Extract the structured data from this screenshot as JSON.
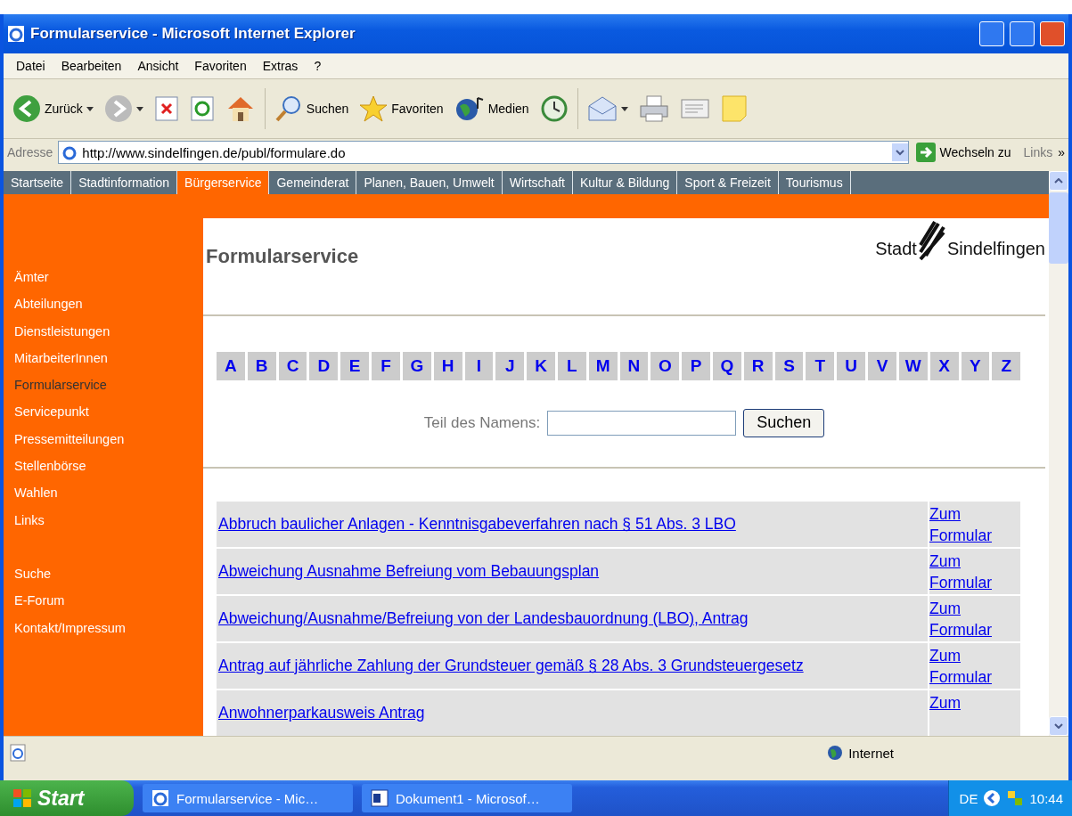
{
  "window": {
    "title": "Formularservice - Microsoft Internet Explorer"
  },
  "menu": [
    "Datei",
    "Bearbeiten",
    "Ansicht",
    "Favoriten",
    "Extras",
    "?"
  ],
  "toolbar": [
    {
      "kind": "back",
      "label": "Zurück"
    },
    {
      "kind": "forward"
    },
    {
      "kind": "stop"
    },
    {
      "kind": "refresh"
    },
    {
      "kind": "home"
    },
    {
      "kind": "search",
      "label": "Suchen"
    },
    {
      "kind": "favorites",
      "label": "Favoriten"
    },
    {
      "kind": "media",
      "label": "Medien"
    },
    {
      "kind": "history"
    },
    {
      "kind": "mail"
    },
    {
      "kind": "print"
    },
    {
      "kind": "edit"
    },
    {
      "kind": "note"
    }
  ],
  "address": {
    "label": "Adresse",
    "url": "http://www.sindelfingen.de/publ/formulare.do",
    "go": "Wechseln zu",
    "links": "Links",
    "more": "»"
  },
  "nav": [
    {
      "label": "Startseite",
      "selected": false
    },
    {
      "label": "Stadtinformation",
      "selected": false
    },
    {
      "label": "Bürgerservice",
      "selected": true
    },
    {
      "label": "Gemeinderat",
      "selected": false
    },
    {
      "label": "Planen, Bauen, Umwelt",
      "selected": false
    },
    {
      "label": "Wirtschaft",
      "selected": false
    },
    {
      "label": "Kultur & Bildung",
      "selected": false
    },
    {
      "label": "Sport & Freizeit",
      "selected": false
    },
    {
      "label": "Tourismus",
      "selected": false
    }
  ],
  "sidebar_main": [
    {
      "label": "Ämter",
      "selected": false
    },
    {
      "label": "Abteilungen",
      "selected": false
    },
    {
      "label": "Dienstleistungen",
      "selected": false
    },
    {
      "label": "MitarbeiterInnen",
      "selected": false
    },
    {
      "label": "Formularservice",
      "selected": true
    },
    {
      "label": "Servicepunkt",
      "selected": false
    },
    {
      "label": "Pressemitteilungen",
      "selected": false
    },
    {
      "label": "Stellenbörse",
      "selected": false
    },
    {
      "label": "Wahlen",
      "selected": false
    },
    {
      "label": "Links",
      "selected": false
    }
  ],
  "sidebar_extra": [
    {
      "label": "Suche",
      "selected": false
    },
    {
      "label": "E-Forum",
      "selected": false
    },
    {
      "label": "Kontakt/Impressum",
      "selected": false
    }
  ],
  "heading": "Formularservice",
  "logo": {
    "left": "Stadt",
    "right": "Sindelfingen"
  },
  "letters": [
    "A",
    "B",
    "C",
    "D",
    "E",
    "F",
    "G",
    "H",
    "I",
    "J",
    "K",
    "L",
    "M",
    "N",
    "O",
    "P",
    "Q",
    "R",
    "S",
    "T",
    "U",
    "V",
    "W",
    "X",
    "Y",
    "Z"
  ],
  "search": {
    "label": "Teil des Namens:",
    "button": "Suchen"
  },
  "forms": [
    {
      "title": "Abbruch baulicher Anlagen - Kenntnisgabeverfahren nach § 51 Abs. 3 LBO",
      "link": "Zum Formular"
    },
    {
      "title": "Abweichung Ausnahme Befreiung vom Bebauungsplan",
      "link": "Zum Formular"
    },
    {
      "title": "Abweichung/Ausnahme/Befreiung von der Landesbauordnung (LBO), Antrag",
      "link": "Zum Formular"
    },
    {
      "title": "Antrag auf jährliche Zahlung der Grundsteuer gemäß § 28 Abs. 3 Grundsteuergesetz",
      "link": "Zum Formular"
    },
    {
      "title": "Anwohnerparkausweis Antrag",
      "link": "Zum"
    }
  ],
  "status": {
    "zone": "Internet"
  },
  "taskbar": {
    "start": "Start",
    "tasks": [
      {
        "label": "Formularservice - Mic…",
        "kind": "ie"
      },
      {
        "label": "Dokument1 - Microsof…",
        "kind": "word"
      }
    ],
    "lang": "DE",
    "time": "10:44"
  }
}
